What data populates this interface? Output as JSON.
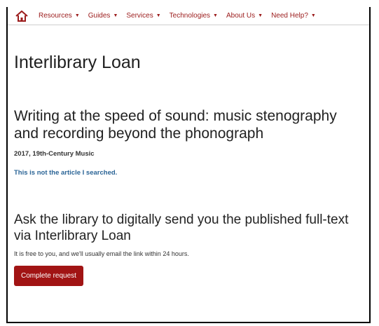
{
  "nav": {
    "home_icon": "home-icon",
    "items": [
      {
        "label": "Resources"
      },
      {
        "label": "Guides"
      },
      {
        "label": "Services"
      },
      {
        "label": "Technologies"
      },
      {
        "label": "About Us"
      },
      {
        "label": "Need Help?"
      }
    ],
    "accent_color": "#9b1b1b"
  },
  "page": {
    "title": "Interlibrary Loan"
  },
  "article": {
    "title": "Writing at the speed of sound: music stenography and recording beyond the phonograph",
    "meta": "2017, 19th-Century Music",
    "not_article_link": "This is not the article I searched."
  },
  "request": {
    "heading": "Ask the library to digitally send you the published full-text via Interlibrary Loan",
    "note": "It is free to you, and we'll usually email the link within 24 hours.",
    "button_label": "Complete request",
    "button_color": "#a11414"
  }
}
